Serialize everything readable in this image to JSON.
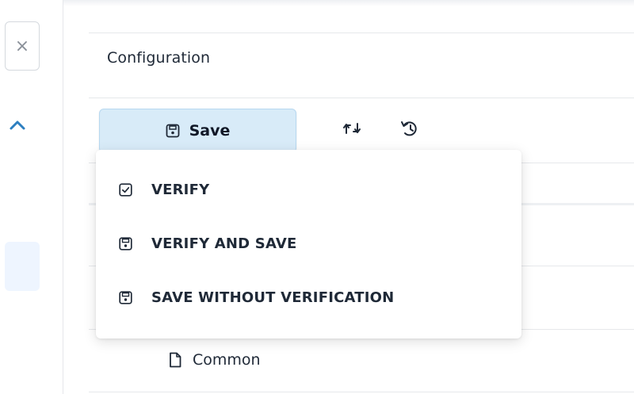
{
  "sidebar": {
    "close_symbol": "×",
    "close_icon": "close-icon",
    "collapse_icon": "chevron-up-icon"
  },
  "panel": {
    "title": "Configuration"
  },
  "toolbar": {
    "save_label": "Save",
    "save_icon": "floppy-disk-icon",
    "sync_icon": "swap-arrows-icon",
    "history_icon": "history-icon"
  },
  "save_menu": {
    "items": [
      {
        "label": "VERIFY",
        "icon": "check-square-icon"
      },
      {
        "label": "VERIFY AND SAVE",
        "icon": "floppy-disk-icon"
      },
      {
        "label": "SAVE WITHOUT VERIFICATION",
        "icon": "floppy-disk-icon"
      }
    ]
  },
  "tree": {
    "common_label": "Common",
    "common_icon": "file-icon"
  },
  "colors": {
    "save_button_bg": "#d8ebf8",
    "accent": "#2d7fc0",
    "sidebar_highlight": "#eef5ff"
  }
}
